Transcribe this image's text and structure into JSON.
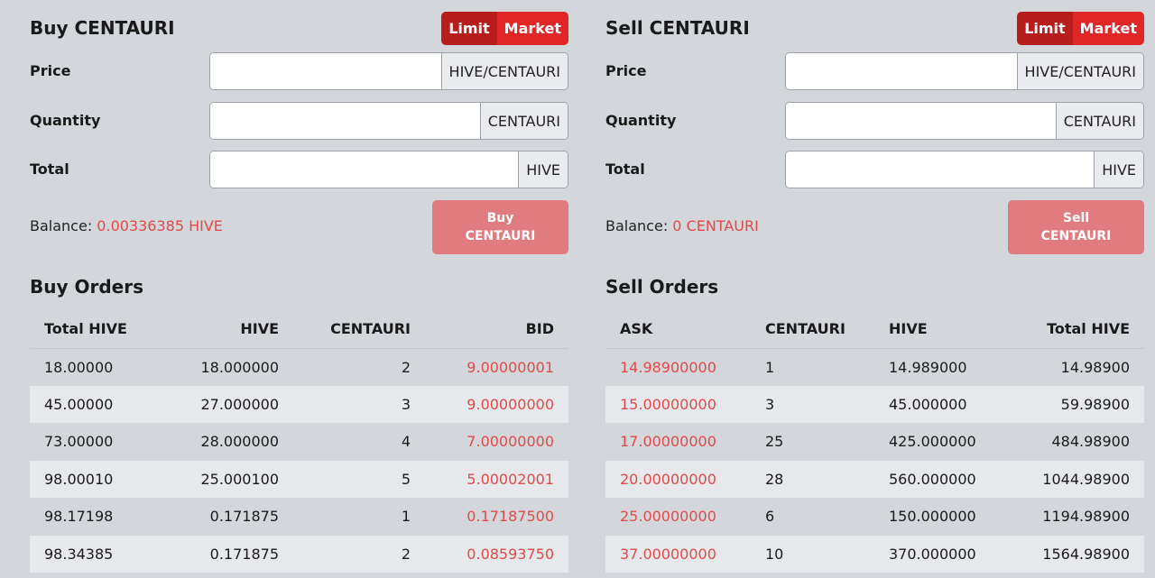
{
  "buy": {
    "title": "Buy CENTAURI",
    "toggle": {
      "limit": "Limit",
      "market": "Market"
    },
    "price_label": "Price",
    "price_unit": "HIVE/CENTAURI",
    "quantity_label": "Quantity",
    "quantity_unit": "CENTAURI",
    "total_label": "Total",
    "total_unit": "HIVE",
    "balance_label": "Balance:",
    "balance_value": "0.00336385 HIVE",
    "button_line1": "Buy",
    "button_line2": "CENTAURI"
  },
  "sell": {
    "title": "Sell CENTAURI",
    "toggle": {
      "limit": "Limit",
      "market": "Market"
    },
    "price_label": "Price",
    "price_unit": "HIVE/CENTAURI",
    "quantity_label": "Quantity",
    "quantity_unit": "CENTAURI",
    "total_label": "Total",
    "total_unit": "HIVE",
    "balance_label": "Balance:",
    "balance_value": "0 CENTAURI",
    "button_line1": "Sell",
    "button_line2": "CENTAURI"
  },
  "buy_orders": {
    "title": "Buy Orders",
    "headers": [
      "Total HIVE",
      "HIVE",
      "CENTAURI",
      "BID"
    ],
    "rows": [
      [
        "18.00000",
        "18.000000",
        "2",
        "9.00000001"
      ],
      [
        "45.00000",
        "27.000000",
        "3",
        "9.00000000"
      ],
      [
        "73.00000",
        "28.000000",
        "4",
        "7.00000000"
      ],
      [
        "98.00010",
        "25.000100",
        "5",
        "5.00002001"
      ],
      [
        "98.17198",
        "0.171875",
        "1",
        "0.17187500"
      ],
      [
        "98.34385",
        "0.171875",
        "2",
        "0.08593750"
      ]
    ]
  },
  "sell_orders": {
    "title": "Sell Orders",
    "headers": [
      "ASK",
      "CENTAURI",
      "HIVE",
      "Total HIVE"
    ],
    "rows": [
      [
        "14.98900000",
        "1",
        "14.989000",
        "14.98900"
      ],
      [
        "15.00000000",
        "3",
        "45.000000",
        "59.98900"
      ],
      [
        "17.00000000",
        "25",
        "425.000000",
        "484.98900"
      ],
      [
        "20.00000000",
        "28",
        "560.000000",
        "1044.98900"
      ],
      [
        "25.00000000",
        "6",
        "150.000000",
        "1194.98900"
      ],
      [
        "37.00000000",
        "10",
        "370.000000",
        "1564.98900"
      ]
    ]
  },
  "colors": {
    "accent": "#e02626",
    "accent_dark": "#b81d1d",
    "price_text": "#e24a4a",
    "disabled_button": "#e07b80",
    "background": "#d3d6da"
  }
}
